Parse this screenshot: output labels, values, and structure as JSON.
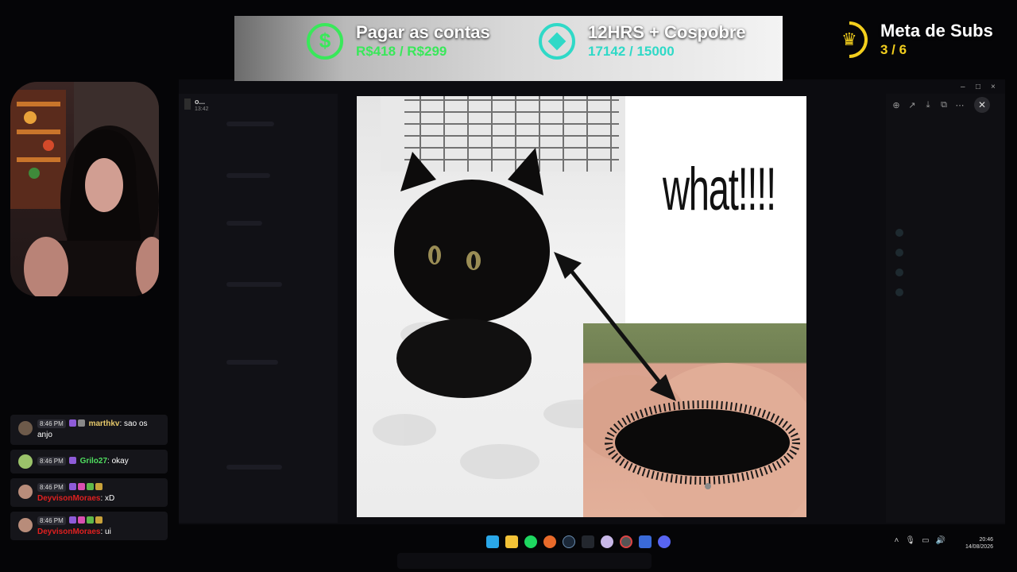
{
  "overlay": {
    "goals": [
      {
        "icon": "dollar-icon",
        "title": "Pagar as contas",
        "progress": "R$418 / R$299",
        "color": "#39e85a"
      },
      {
        "icon": "diamond-icon",
        "title": "12HRS + Cospobre",
        "progress": "17142 / 15000",
        "color": "#2fd9c7"
      },
      {
        "icon": "crown-icon",
        "title": "Meta de Subs",
        "progress": "3 / 6",
        "color": "#f3cf1d"
      }
    ]
  },
  "chat": {
    "messages": [
      {
        "time": "8:46 PM",
        "user": "marthkv",
        "user_color": "#e6c86a",
        "text": ": sao os anjo"
      },
      {
        "time": "8:46 PM",
        "user": "Grilo27",
        "user_color": "#4fde5f",
        "text": ": okay"
      },
      {
        "time": "8:46 PM",
        "user": "DeyvisonMoraes",
        "user_color": "#e02020",
        "text": ": xD"
      },
      {
        "time": "8:46 PM",
        "user": "DeyvisonMoraes",
        "user_color": "#e02020",
        "text": ": ui"
      }
    ]
  },
  "viewer": {
    "title": "o...",
    "subtitle": "13:42",
    "toolbar": {
      "zoom_icon": "zoom-icon",
      "share_icon": "share-icon",
      "download_icon": "download-icon",
      "open_icon": "open-external-icon",
      "more_icon": "more-icon",
      "close_icon": "close-icon"
    },
    "image": {
      "caption": "what!!!!"
    }
  },
  "window_controls": {
    "minimize": "–",
    "maximize": "□",
    "close": "×"
  },
  "taskbar": {
    "apps": [
      "windows-start-icon",
      "file-explorer-icon",
      "spotify-icon",
      "firefox-icon",
      "steam-icon",
      "terminal-icon",
      "obs-icon",
      "chrome-icon",
      "vpn-icon",
      "discord-icon"
    ],
    "clock_time": "20:46",
    "clock_date": "14/08/2026"
  }
}
